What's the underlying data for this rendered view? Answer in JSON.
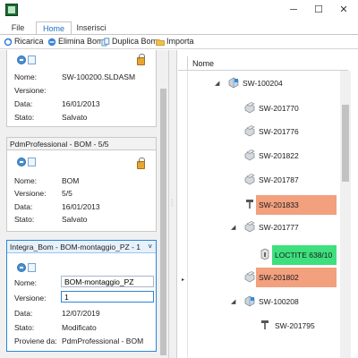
{
  "window": {
    "controls": {
      "minimize": "─",
      "maximize": "☐",
      "close": "✕"
    }
  },
  "ribbon": {
    "tabs": [
      {
        "label": "File"
      },
      {
        "label": "Home"
      },
      {
        "label": "Inserisci"
      }
    ],
    "active_tab": "Home",
    "actions": [
      {
        "label": "Ricarica",
        "icon": "reload-icon"
      },
      {
        "label": "Elimina Bom",
        "icon": "delete-icon"
      },
      {
        "label": "Duplica Bom",
        "icon": "duplicate-icon"
      },
      {
        "label": "Importa",
        "icon": "folder-icon"
      }
    ]
  },
  "labels": {
    "nome": "Nome:",
    "versione": "Versione:",
    "data": "Data:",
    "stato": "Stato:",
    "proviene": "Proviene da:"
  },
  "cards": [
    {
      "header": "",
      "nome": "SW-100200.SLDASM",
      "versione": "",
      "data": "16/01/2013",
      "stato": "Salvato",
      "locked": true
    },
    {
      "header": "PdmProfessional - BOM - 5/5",
      "nome": "BOM",
      "versione": "5/5",
      "data": "16/01/2013",
      "stato": "Salvato",
      "locked": true
    },
    {
      "header": "Integra_Bom - BOM-montaggio_PZ - 1",
      "caret": "˅",
      "nome": "BOM-montaggio_PZ",
      "versione": "1",
      "data": "12/07/2019",
      "stato": "Modificato",
      "proviene": "PdmProfessional - BOM",
      "locked": false
    }
  ],
  "tree": {
    "column_header": "Nome",
    "nodes": [
      {
        "label": "SW-100204",
        "expander": "◢",
        "type": "assembly",
        "highlight": ""
      },
      {
        "label": "SW-201770",
        "expander": "",
        "type": "part",
        "highlight": ""
      },
      {
        "label": "SW-201776",
        "expander": "",
        "type": "part",
        "highlight": ""
      },
      {
        "label": "SW-201822",
        "expander": "",
        "type": "part",
        "highlight": ""
      },
      {
        "label": "SW-201787",
        "expander": "",
        "type": "part",
        "highlight": ""
      },
      {
        "label": "SW-201833",
        "expander": "",
        "type": "screw",
        "highlight": "orange"
      },
      {
        "label": "SW-201777",
        "expander": "◢",
        "type": "part",
        "highlight": ""
      },
      {
        "label": "LOCTITE 638/10",
        "expander": "",
        "type": "glue",
        "highlight": "green"
      },
      {
        "label": "SW-201802",
        "expander": "",
        "type": "part",
        "highlight": "orange"
      },
      {
        "label": "SW-100208",
        "expander": "◢",
        "type": "assembly",
        "highlight": ""
      },
      {
        "label": "SW-201795",
        "expander": "",
        "type": "screw",
        "highlight": ""
      }
    ],
    "row_pointer": "▸"
  },
  "colors": {
    "accent": "#1e6fc4",
    "highlight_orange": "#f2a07e",
    "highlight_green": "#3ee07e",
    "focus_border": "#2e86d9"
  }
}
